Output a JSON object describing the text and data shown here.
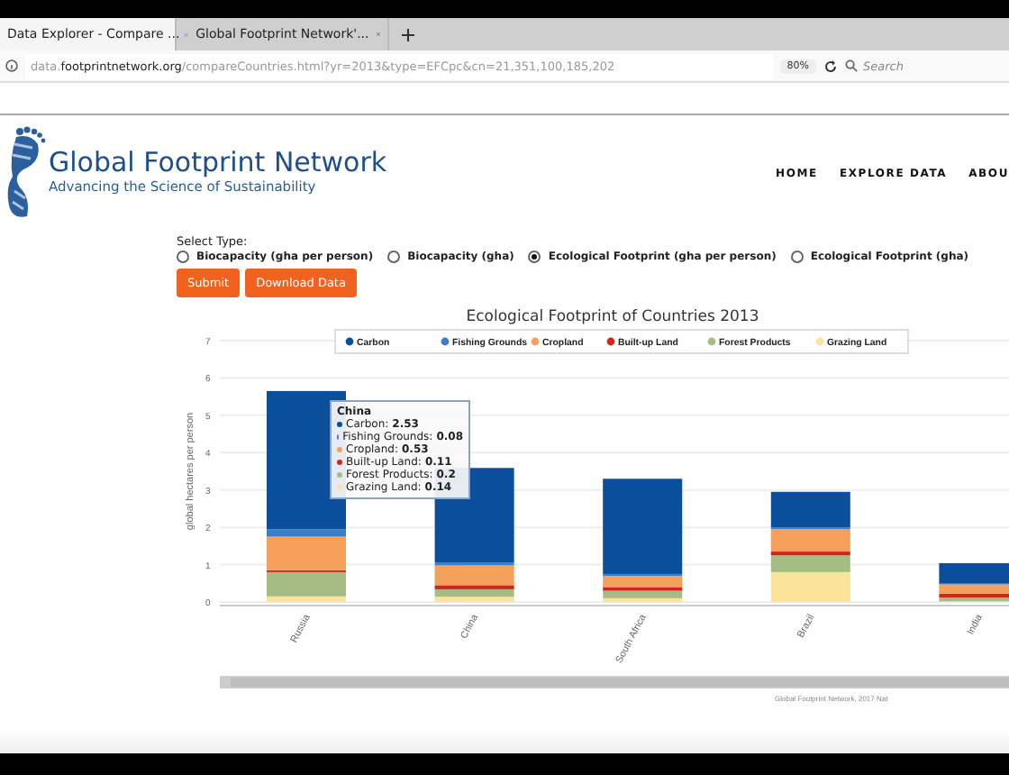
{
  "browser": {
    "tabs": [
      {
        "title": "Data Explorer - Compare ...",
        "selected": true
      },
      {
        "title": "Global Footprint Network'...",
        "selected": false
      }
    ],
    "url": {
      "host_prefix": "data.",
      "host": "footprintnetwork.org",
      "path": "/compareCountries.html?yr=2013&type=EFCpc&cn=21,351,100,185,202"
    },
    "zoom": "80%",
    "search": {
      "placeholder": "Search"
    }
  },
  "site": {
    "logo": {
      "title": "Global Footprint Network",
      "tagline": "Advancing the Science of Sustainability"
    },
    "nav": [
      "HOME",
      "EXPLORE DATA",
      "ABOU"
    ]
  },
  "form": {
    "label": "Select Type:",
    "options": [
      {
        "label": "Biocapacity (gha per person)",
        "selected": false
      },
      {
        "label": "Biocapacity (gha)",
        "selected": false
      },
      {
        "label": "Ecological Footprint (gha per person)",
        "selected": true
      },
      {
        "label": "Ecological Footprint (gha)",
        "selected": false
      }
    ],
    "buttons": [
      "Submit",
      "Download Data"
    ]
  },
  "chart": {
    "chart_data": {
      "type": "bar",
      "stacked": true,
      "title": "Ecological Footprint of Countries 2013",
      "ylabel": "global hectares per person",
      "categories": [
        "Russia",
        "China",
        "South Africa",
        "Brazil",
        "India"
      ],
      "ylim": [
        0,
        7
      ],
      "yticks": [
        0,
        1,
        2,
        3,
        4,
        5,
        6,
        7
      ],
      "grid": true,
      "legend": true,
      "series": [
        {
          "name": "Grazing Land",
          "color": "#fbe39a",
          "values": [
            0.15,
            0.14,
            0.1,
            0.8,
            0.02
          ]
        },
        {
          "name": "Forest Products",
          "color": "#a5bd84",
          "values": [
            0.65,
            0.2,
            0.2,
            0.45,
            0.1
          ]
        },
        {
          "name": "Built-up Land",
          "color": "#d0261f",
          "values": [
            0.05,
            0.11,
            0.1,
            0.1,
            0.1
          ]
        },
        {
          "name": "Cropland",
          "color": "#f5a05a",
          "values": [
            0.9,
            0.53,
            0.3,
            0.6,
            0.25
          ]
        },
        {
          "name": "Fishing Grounds",
          "color": "#3d7ec9",
          "values": [
            0.2,
            0.08,
            0.05,
            0.05,
            0.02
          ]
        },
        {
          "name": "Carbon",
          "color": "#0b4f9c",
          "values": [
            3.7,
            2.53,
            2.55,
            0.95,
            0.55
          ]
        }
      ]
    },
    "tooltip": {
      "title": "China",
      "rows": [
        {
          "label": "Carbon:",
          "value": "2.53",
          "color": "#0b4f9c"
        },
        {
          "label": "Fishing Grounds:",
          "value": "0.08",
          "color": "#3d7ec9"
        },
        {
          "label": "Cropland:",
          "value": "0.53",
          "color": "#f5a05a"
        },
        {
          "label": "Built-up Land:",
          "value": "0.11",
          "color": "#d0261f"
        },
        {
          "label": "Forest Products:",
          "value": "0.2",
          "color": "#a5bd84"
        },
        {
          "label": "Grazing Land:",
          "value": "0.14",
          "color": "#fbe39a"
        }
      ]
    },
    "credit": "Global Footprint Network, 2017 Nat"
  }
}
